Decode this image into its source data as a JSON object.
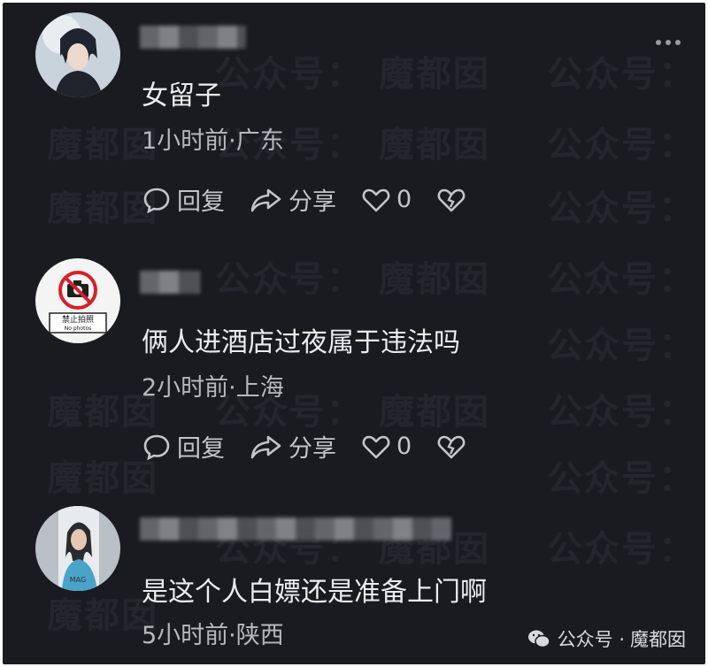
{
  "watermark": {
    "text1": "魔都囡",
    "text2": "公众号："
  },
  "comments": [
    {
      "text": "女留子",
      "meta": "1小时前·广东",
      "reply_label": "回复",
      "share_label": "分享",
      "like_count": "0"
    },
    {
      "text": "俩人进酒店过夜属于违法吗",
      "meta": "2小时前·上海",
      "reply_label": "回复",
      "share_label": "分享",
      "like_count": "0",
      "avatar_text_1": "禁止拍照",
      "avatar_text_2": "No photos"
    },
    {
      "text": "是这个人白嫖还是准备上门啊",
      "meta": "5小时前·陕西",
      "avatar_text_1": "MAG"
    }
  ],
  "source_tag": {
    "prefix": "公众号 ·",
    "name": "魔都囡"
  },
  "colors": {
    "background": "#1a1b21",
    "text": "#ececef",
    "meta": "#b7b8be"
  }
}
